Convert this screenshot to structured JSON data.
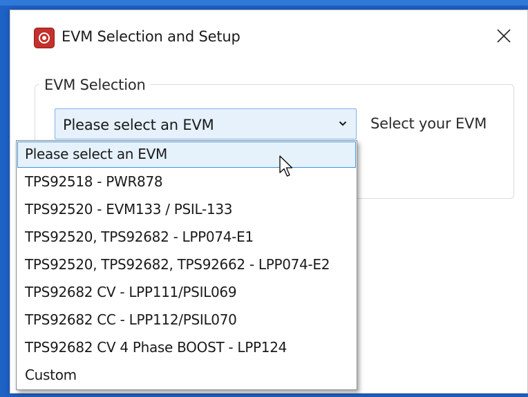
{
  "window": {
    "title": "EVM Selection and Setup",
    "close_icon": "close-icon",
    "app_icon": "app-logo-icon"
  },
  "group": {
    "legend": "EVM Selection"
  },
  "combo": {
    "value": "Please select an EVM",
    "hint": "Select your EVM",
    "arrow_icon": "chevron-down-icon"
  },
  "dropdown": {
    "options": [
      "Please select an EVM",
      "TPS92518 - PWR878",
      "TPS92520 - EVM133 / PSIL-133",
      "TPS92520, TPS92682 - LPP074-E1",
      "TPS92520, TPS92682, TPS92662 - LPP074-E2",
      "TPS92682 CV - LPP111/PSIL069",
      "TPS92682 CC - LPP112/PSIL070",
      "TPS92682 CV 4 Phase BOOST - LPP124",
      "Custom"
    ],
    "selected_index": 0
  },
  "colors": {
    "frame": "#1e62c6",
    "selection_fill": "#e5f1fb",
    "selection_border": "#3c94e0",
    "app_icon": "#c4302b"
  }
}
